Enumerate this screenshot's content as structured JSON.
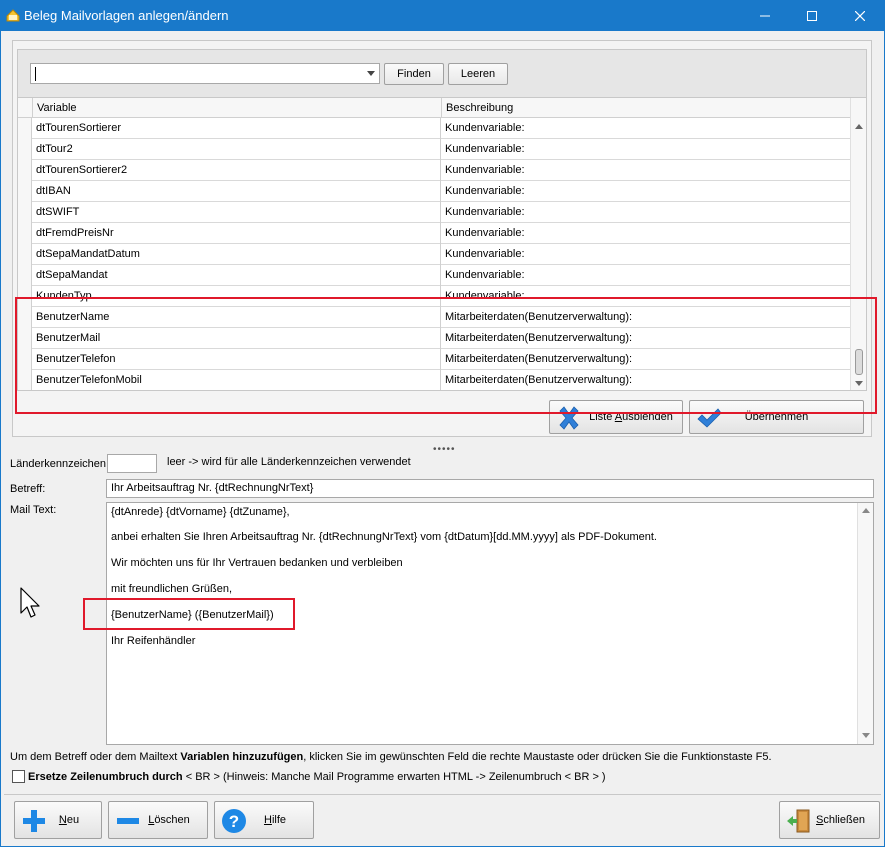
{
  "window": {
    "title": "Beleg Mailvorlagen anlegen/ändern"
  },
  "search": {
    "combo_value": "",
    "find_label": "Finden",
    "clear_label": "Leeren"
  },
  "grid": {
    "columns": [
      "Variable",
      "Beschreibung"
    ],
    "rows": [
      {
        "variable": "dtTourenSortierer",
        "beschreibung": "Kundenvariable:"
      },
      {
        "variable": "dtTour2",
        "beschreibung": "Kundenvariable:"
      },
      {
        "variable": "dtTourenSortierer2",
        "beschreibung": "Kundenvariable:"
      },
      {
        "variable": "dtIBAN",
        "beschreibung": "Kundenvariable:"
      },
      {
        "variable": "dtSWIFT",
        "beschreibung": "Kundenvariable:"
      },
      {
        "variable": "dtFremdPreisNr",
        "beschreibung": "Kundenvariable:"
      },
      {
        "variable": "dtSepaMandatDatum",
        "beschreibung": "Kundenvariable:"
      },
      {
        "variable": "dtSepaMandat",
        "beschreibung": "Kundenvariable:"
      },
      {
        "variable": "KundenTyp",
        "beschreibung": "Kundenvariable:"
      },
      {
        "variable": "BenutzerName",
        "beschreibung": "Mitarbeiterdaten(Benutzerverwaltung):"
      },
      {
        "variable": "BenutzerMail",
        "beschreibung": "Mitarbeiterdaten(Benutzerverwaltung):"
      },
      {
        "variable": "BenutzerTelefon",
        "beschreibung": "Mitarbeiterdaten(Benutzerverwaltung):"
      },
      {
        "variable": "BenutzerTelefonMobil",
        "beschreibung": "Mitarbeiterdaten(Benutzerverwaltung):"
      }
    ]
  },
  "actions": {
    "hide_list_pre": "Liste ",
    "hide_list_acc": "A",
    "hide_list_post": "usblenden",
    "apply_label": "Übernehmen"
  },
  "splitter": "•••••",
  "form": {
    "country_label": "Länderkennzeichen",
    "country_value": "",
    "country_hint": "leer -> wird für alle Länderkennzeichen verwendet",
    "subject_label": "Betreff:",
    "subject_value": "Ihr Arbeitsauftrag Nr. {dtRechnungNrText}",
    "mailtext_label": "Mail Text:",
    "mailtext_lines": [
      "{dtAnrede} {dtVorname} {dtZuname},",
      "anbei erhalten Sie Ihren Arbeitsauftrag Nr. {dtRechnungNrText} vom {dtDatum}[dd.MM.yyyy] als PDF-Dokument.",
      "Wir möchten uns für Ihr Vertrauen bedanken und verbleiben",
      "mit freundlichen Grüßen,",
      "{BenutzerName} ({BenutzerMail})",
      "Ihr Reifenhändler"
    ]
  },
  "hint": {
    "pre": "Um dem Betreff oder dem Mailtext ",
    "bold": "Variablen hinzuzufügen",
    "post": ", klicken Sie im gewünschten Feld die rechte Maustaste oder drücken Sie die Funktionstaste F5."
  },
  "checkbox": {
    "bold": "Ersetze Zeilenumbruch durch",
    "rest": " < BR > (Hinweis: Manche Mail Programme erwarten HTML -> Zeilenumbruch < BR > )",
    "checked": false
  },
  "buttons": {
    "new_acc": "N",
    "new_rest": "eu",
    "delete_acc": "L",
    "delete_rest": "öschen",
    "help_acc": "H",
    "help_rest": "ilfe",
    "close_acc": "S",
    "close_rest": "chließen"
  },
  "colors": {
    "titlebar": "#1979ca",
    "highlight_red": "#e0192b",
    "icon_blue": "#1e88e5"
  }
}
